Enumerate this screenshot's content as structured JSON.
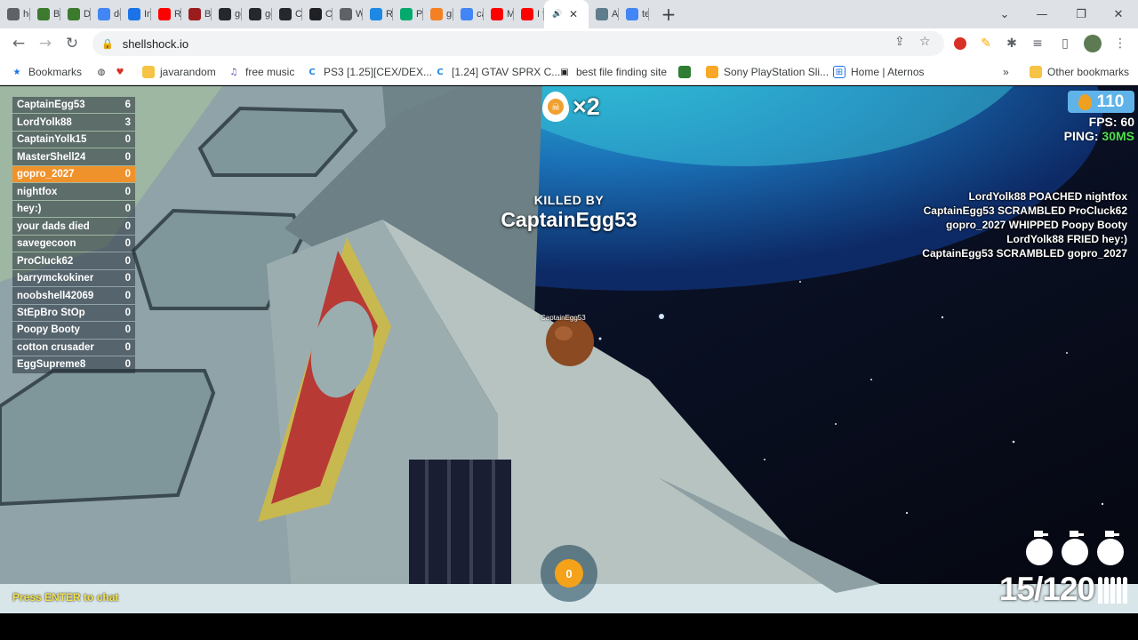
{
  "browser": {
    "tabs": [
      {
        "title": "hc",
        "icon": "page-icon",
        "color": "#5f6368"
      },
      {
        "title": "Bu",
        "icon": "minecraft-icon",
        "color": "#3c7a2e"
      },
      {
        "title": "Dc",
        "icon": "minecraft-icon",
        "color": "#3c7a2e"
      },
      {
        "title": "de",
        "icon": "google-icon",
        "color": "#4285f4"
      },
      {
        "title": "Im",
        "icon": "chart-icon",
        "color": "#1a73e8"
      },
      {
        "title": "Ru",
        "icon": "youtube-icon",
        "color": "#ff0000"
      },
      {
        "title": "Be",
        "icon": "m-icon",
        "color": "#9b1c1c"
      },
      {
        "title": "gc",
        "icon": "github-icon",
        "color": "#24292f"
      },
      {
        "title": "gc",
        "icon": "github-icon",
        "color": "#24292f"
      },
      {
        "title": "Cl",
        "icon": "github-icon",
        "color": "#24292f"
      },
      {
        "title": "Op",
        "icon": "openai-icon",
        "color": "#202124"
      },
      {
        "title": "W",
        "icon": "globe-icon",
        "color": "#5f6368"
      },
      {
        "title": "Re",
        "icon": "react-icon",
        "color": "#1e88e5"
      },
      {
        "title": "Py",
        "icon": "w3-icon",
        "color": "#04aa6d"
      },
      {
        "title": "gi",
        "icon": "stack-icon",
        "color": "#f48024"
      },
      {
        "title": "ca",
        "icon": "google-icon",
        "color": "#4285f4"
      },
      {
        "title": "M",
        "icon": "youtube-icon",
        "color": "#ff0000"
      },
      {
        "title": "I t",
        "icon": "youtube-icon",
        "color": "#ff0000"
      },
      {
        "title": "",
        "icon": "speaker-icon",
        "color": "#3c4043",
        "active": true
      },
      {
        "title": "A",
        "icon": "image-icon",
        "color": "#607d8b"
      },
      {
        "title": "te",
        "icon": "google-icon",
        "color": "#4285f4"
      }
    ],
    "url": "shellshock.io",
    "bookmarks": [
      {
        "label": "Bookmarks",
        "icon": "star-icon"
      },
      {
        "label": "",
        "icon": "globe-icon"
      },
      {
        "label": "",
        "icon": "heart-icon"
      },
      {
        "label": "javarandom",
        "icon": "folder-icon"
      },
      {
        "label": "free music",
        "icon": "music-icon"
      },
      {
        "label": "PS3 [1.25][CEX/DEX...",
        "icon": "c-icon"
      },
      {
        "label": "[1.24] GTAV SPRX C...",
        "icon": "c-icon"
      },
      {
        "label": "best file finding site",
        "icon": "robot-icon"
      },
      {
        "label": "",
        "icon": "app-icon"
      },
      {
        "label": "Sony PlayStation Sli...",
        "icon": "bag-icon"
      },
      {
        "label": "Home | Aternos",
        "icon": "grid-icon"
      },
      {
        "label": "Other bookmarks",
        "icon": "folder-icon"
      }
    ]
  },
  "game": {
    "scoreboard": [
      {
        "name": "CaptainEgg53",
        "score": "6"
      },
      {
        "name": "LordYolk88",
        "score": "3"
      },
      {
        "name": "CaptainYolk15",
        "score": "0"
      },
      {
        "name": "MasterShell24",
        "score": "0"
      },
      {
        "name": "gopro_2027",
        "score": "0",
        "me": true
      },
      {
        "name": "nightfox",
        "score": "0"
      },
      {
        "name": "hey:)",
        "score": "0"
      },
      {
        "name": "your dads died",
        "score": "0"
      },
      {
        "name": "savegecoon",
        "score": "0"
      },
      {
        "name": "ProCluck62",
        "score": "0"
      },
      {
        "name": "barrymckokiner",
        "score": "0"
      },
      {
        "name": "noobshell42069",
        "score": "0"
      },
      {
        "name": "StEpBro StOp",
        "score": "0"
      },
      {
        "name": "Poopy Booty",
        "score": "0"
      },
      {
        "name": "cotton crusader",
        "score": "0"
      },
      {
        "name": "EggSupreme8",
        "score": "0"
      }
    ],
    "streak": "×2",
    "killed_by_label": "KILLED BY",
    "killer": "CaptainEgg53",
    "killer_tag": "CaptainEgg53",
    "eggs": "110",
    "fps_label": "FPS: 60",
    "ping_label": "PING:",
    "ping_value": "30MS",
    "killfeed": [
      "LordYolk88 POACHED nightfox",
      "CaptainEgg53 SCRAMBLED ProCluck62",
      "gopro_2027 WHIPPED Poopy Booty",
      "LordYolk88 FRIED hey:)",
      "CaptainEgg53 SCRAMBLED gopro_2027"
    ],
    "chat_hint": "Press ENTER to chat",
    "respawn_timer": "0",
    "grenades": 3,
    "ammo": "15/120",
    "colors": {
      "me_row": "#f0922b",
      "ping_good": "#4ee04e",
      "egg_badge": "#5fb3e8",
      "timer_coin": "#f3a21a"
    }
  }
}
